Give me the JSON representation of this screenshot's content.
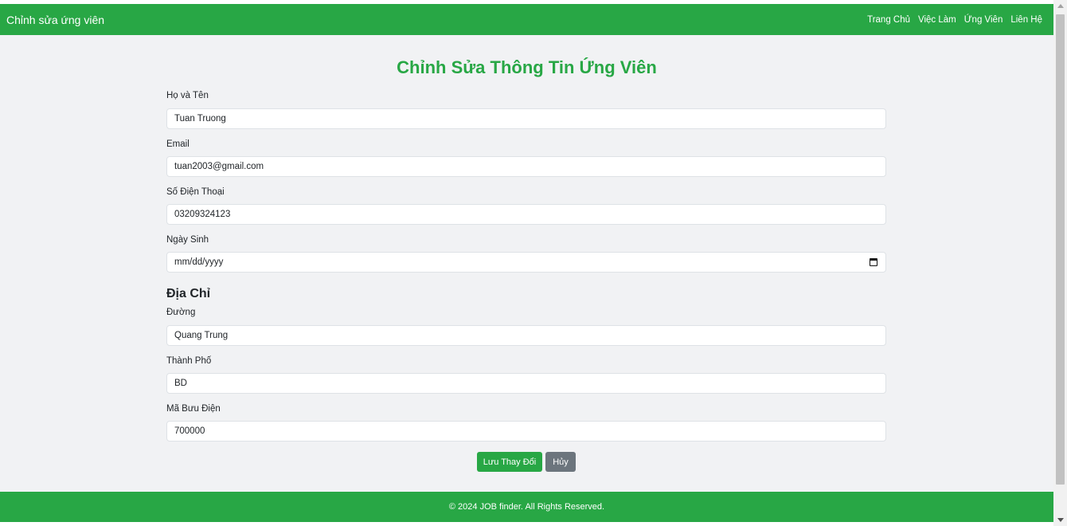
{
  "navbar": {
    "brand": "Chỉnh sửa ứng viên",
    "links": [
      "Trang Chủ",
      "Việc Làm",
      "Ứng Viên",
      "Liên Hệ"
    ]
  },
  "form": {
    "title": "Chỉnh Sửa Thông Tin Ứng Viên",
    "fullname": {
      "label": "Họ và Tên",
      "value": "Tuan Truong"
    },
    "email": {
      "label": "Email",
      "value": "tuan2003@gmail.com"
    },
    "phone": {
      "label": "Số Điện Thoại",
      "value": "03209324123"
    },
    "birthdate": {
      "label": "Ngày Sinh",
      "value": "mm/dd/yyyy"
    },
    "address_heading": "Địa Chỉ",
    "street": {
      "label": "Đường",
      "value": "Quang Trung"
    },
    "city": {
      "label": "Thành Phố",
      "value": "BD"
    },
    "postal": {
      "label": "Mã Bưu Điện",
      "value": "700000"
    },
    "save_label": "Lưu Thay Đổi",
    "cancel_label": "Hủy"
  },
  "footer": {
    "text": "© 2024 JOB finder. All Rights Reserved."
  },
  "colors": {
    "primary": "#28a745",
    "secondary": "#6c757d",
    "background": "#f1f2f4"
  }
}
